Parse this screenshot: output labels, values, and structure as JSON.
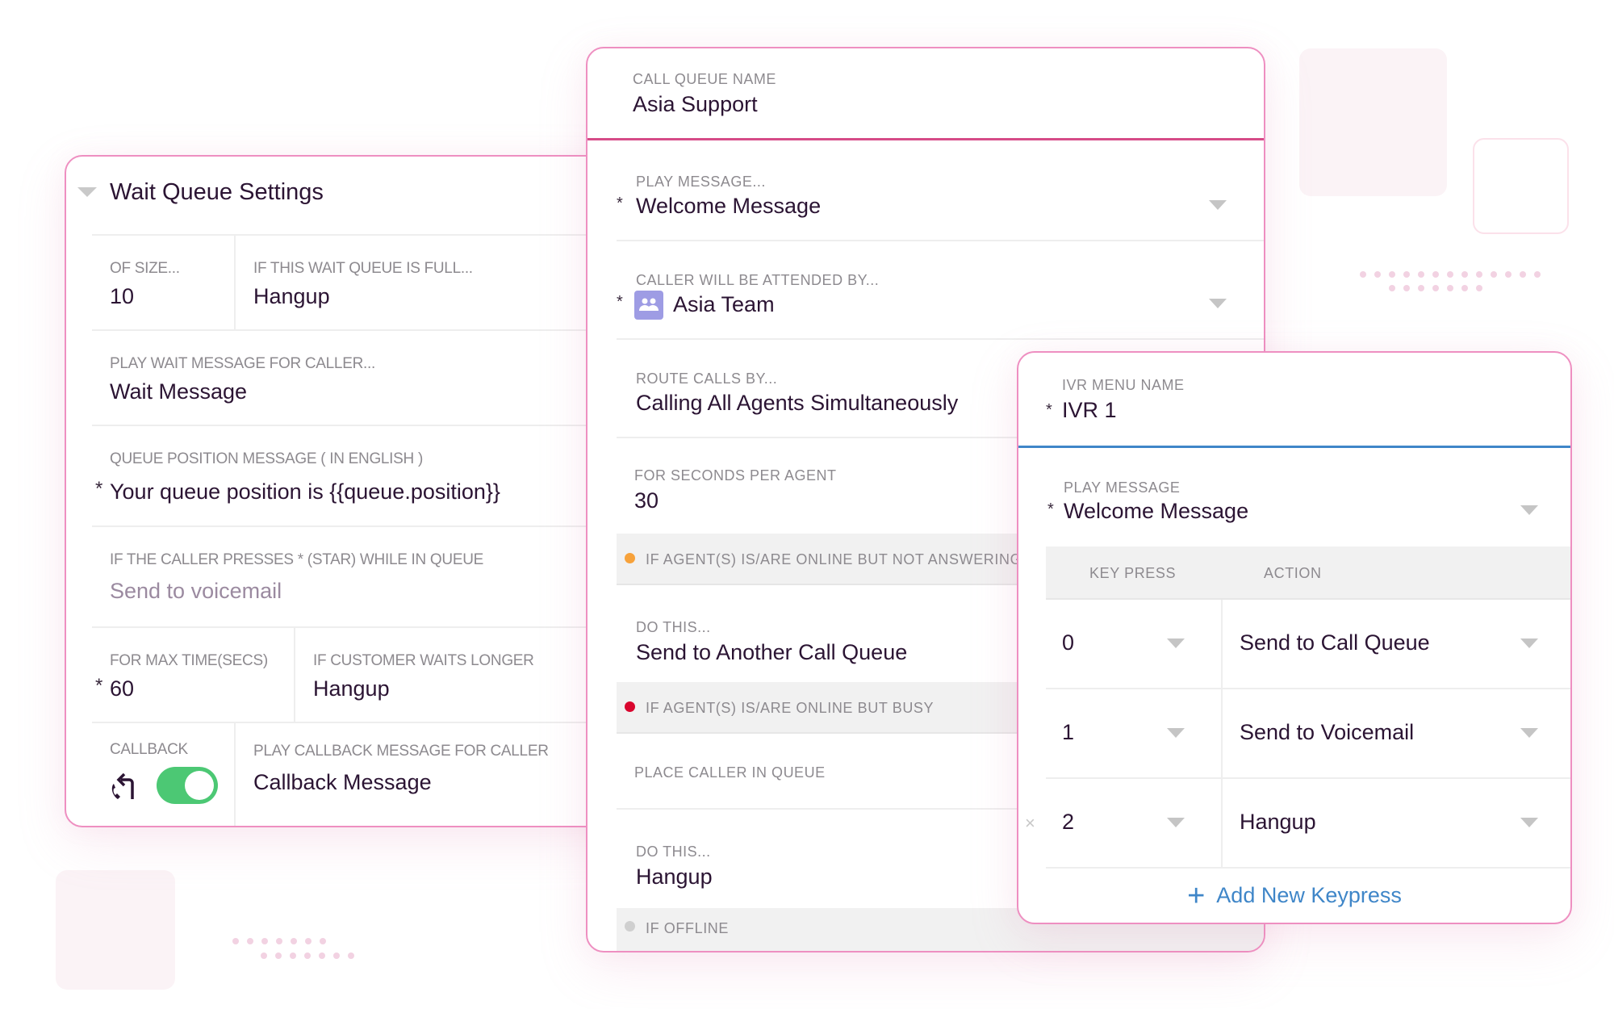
{
  "left_panel": {
    "title": "Wait Queue Settings",
    "of_size": {
      "label": "OF SIZE...",
      "value": "10"
    },
    "if_full": {
      "label": "IF THIS WAIT QUEUE IS FULL...",
      "value": "Hangup"
    },
    "wait_message": {
      "label": "PLAY WAIT MESSAGE FOR CALLER...",
      "value": "Wait Message"
    },
    "queue_position": {
      "label": "QUEUE POSITION MESSAGE  ( IN ENGLISH )",
      "required": "*",
      "value": "Your queue position is {{queue.position}}"
    },
    "star_press": {
      "label": "IF THE CALLER PRESSES * (STAR) WHILE IN QUEUE",
      "placeholder": "Send to voicemail"
    },
    "max_time": {
      "label": "FOR MAX TIME(SECS)",
      "required": "*",
      "value": "60"
    },
    "waits_longer": {
      "label": "IF CUSTOMER WAITS LONGER",
      "value": "Hangup"
    },
    "callback": {
      "label": "CALLBACK",
      "icon": "callback-phone-icon",
      "enabled": true,
      "toggle_color": "#4cc874"
    },
    "callback_message": {
      "label": "PLAY CALLBACK MESSAGE FOR CALLER",
      "value": "Callback Message"
    }
  },
  "center_panel": {
    "queue_name": {
      "label": "CALL QUEUE NAME",
      "value": "Asia Support"
    },
    "play_message": {
      "label": "PLAY MESSAGE...",
      "required": "*",
      "value": "Welcome Message"
    },
    "attended_by": {
      "label": "CALLER WILL BE ATTENDED BY...",
      "required": "*",
      "icon": "team-icon",
      "value": "Asia Team"
    },
    "route_calls": {
      "label": "ROUTE CALLS BY...",
      "value": "Calling All Agents Simultaneously"
    },
    "seconds_per_agent": {
      "label": "FOR SECONDS PER AGENT",
      "value": "30"
    },
    "not_answering": {
      "label": "IF AGENT(S) IS/ARE ONLINE BUT NOT ANSWERING",
      "status_color": "#f7a23b"
    },
    "do_this_1": {
      "label": "DO THIS...",
      "value": "Send to Another Call Queue"
    },
    "busy": {
      "label": "IF AGENT(S) IS/ARE ONLINE BUT BUSY",
      "status_color": "#d9062e"
    },
    "place_in_queue": {
      "label": "PLACE CALLER IN QUEUE"
    },
    "do_this_2": {
      "label": "DO THIS...",
      "value": "Hangup"
    },
    "offline": {
      "label": "IF OFFLINE",
      "status_color": "#cfcfcf"
    }
  },
  "ivr_panel": {
    "menu_name": {
      "label": "IVR MENU NAME",
      "required": "*",
      "value": "IVR 1"
    },
    "play_message": {
      "label": "PLAY MESSAGE",
      "required": "*",
      "value": "Welcome Message"
    },
    "table": {
      "headers": [
        "KEY PRESS",
        "ACTION"
      ],
      "rows": [
        {
          "key": "0",
          "action": "Send to Call Queue",
          "removable": false
        },
        {
          "key": "1",
          "action": "Send to Voicemail",
          "removable": false
        },
        {
          "key": "2",
          "action": "Hangup",
          "removable": true,
          "remove_glyph": "×"
        }
      ]
    },
    "add_button": {
      "icon": "+",
      "label": "Add New Keypress"
    }
  },
  "colors": {
    "panel_border": "#ee8fc1",
    "center_header_divider": "#d64c88",
    "ivr_header_divider": "#3f86c8",
    "link_blue": "#3f86c8",
    "text_primary": "#2b1433"
  }
}
